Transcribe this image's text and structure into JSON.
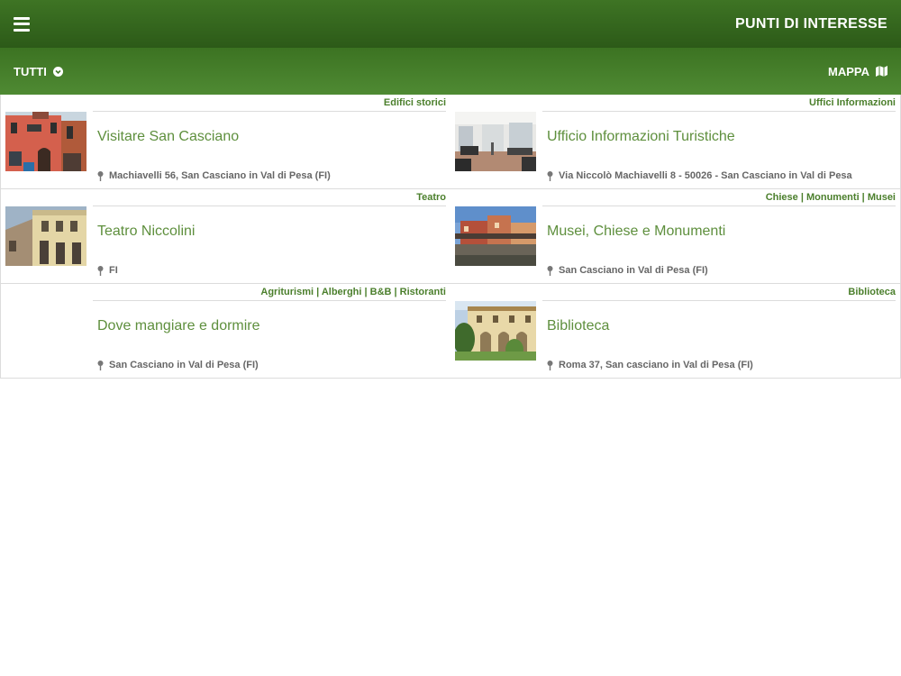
{
  "header": {
    "title": "PUNTI DI INTERESSE"
  },
  "filter": {
    "label": "TUTTI",
    "map_label": "MAPPA"
  },
  "items": [
    {
      "tags": "Edifici storici",
      "name": "Visitare San Casciano",
      "address": "Machiavelli 56, San Casciano in Val di Pesa (FI)"
    },
    {
      "tags": "Uffici Informazioni",
      "name": "Ufficio Informazioni Turistiche",
      "address": "Via Niccolò Machiavelli 8 - 50026 - San Casciano in Val di Pesa"
    },
    {
      "tags": "Teatro",
      "name": "Teatro Niccolini",
      "address": "FI"
    },
    {
      "tags": "Chiese | Monumenti | Musei",
      "name": "Musei, Chiese e Monumenti",
      "address": "San Casciano in Val di Pesa (FI)"
    },
    {
      "tags": "Agriturismi | Alberghi | B&B | Ristoranti",
      "name": "Dove mangiare e dormire",
      "address": "San Casciano in Val di Pesa (FI)"
    },
    {
      "tags": "Biblioteca",
      "name": "Biblioteca",
      "address": "Roma 37, San casciano in Val di Pesa (FI)"
    }
  ]
}
